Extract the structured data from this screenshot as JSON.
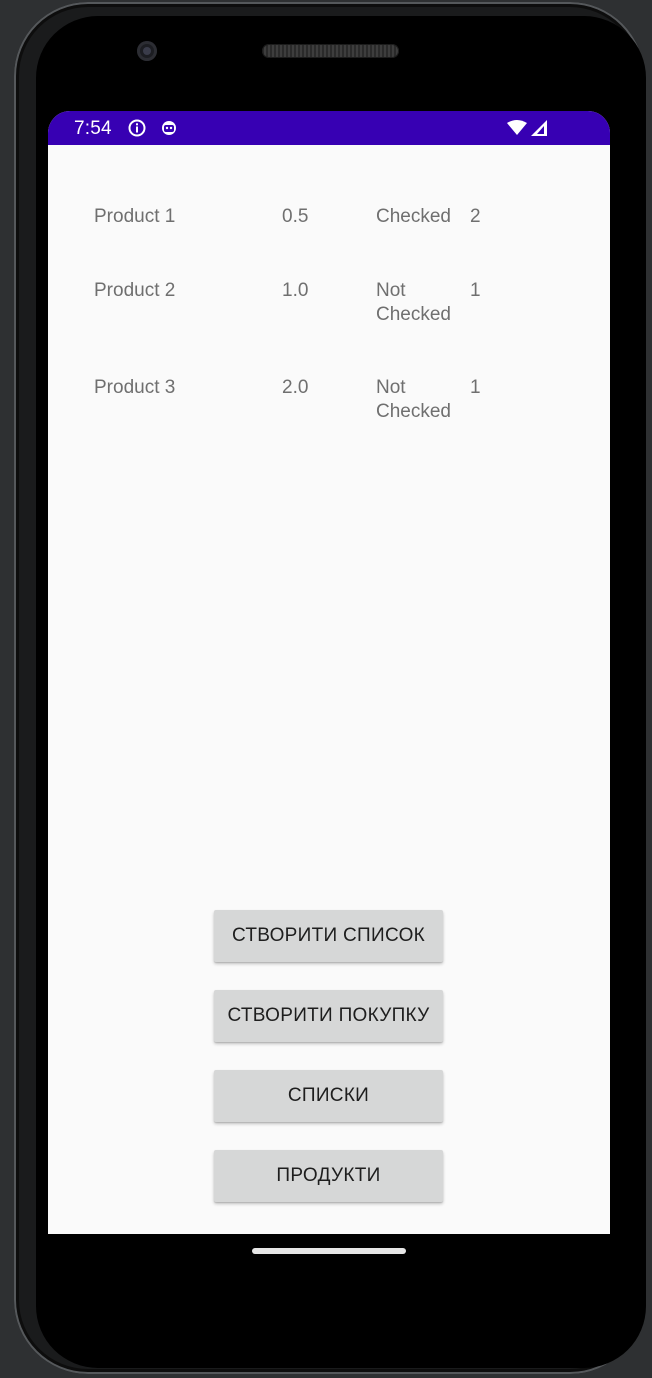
{
  "status_bar": {
    "time": "7:54",
    "background_color": "#3700b3",
    "left_icons": [
      "info-icon",
      "android-robot-icon"
    ],
    "right_icons": [
      "wifi-icon",
      "cellular-signal-icon"
    ]
  },
  "products": [
    {
      "name": "Product 1",
      "price": "0.5",
      "status": "Checked",
      "quantity": "2"
    },
    {
      "name": "Product 2",
      "price": "1.0",
      "status": "Not Checked",
      "quantity": "1"
    },
    {
      "name": "Product 3",
      "price": "2.0",
      "status": "Not Checked",
      "quantity": "1"
    }
  ],
  "buttons": {
    "create_list": "СТВОРИТИ СПИСОК",
    "create_purchase": "СТВОРИТИ ПОКУПКУ",
    "lists": "СПИСКИ",
    "products": "ПРОДУКТИ"
  }
}
